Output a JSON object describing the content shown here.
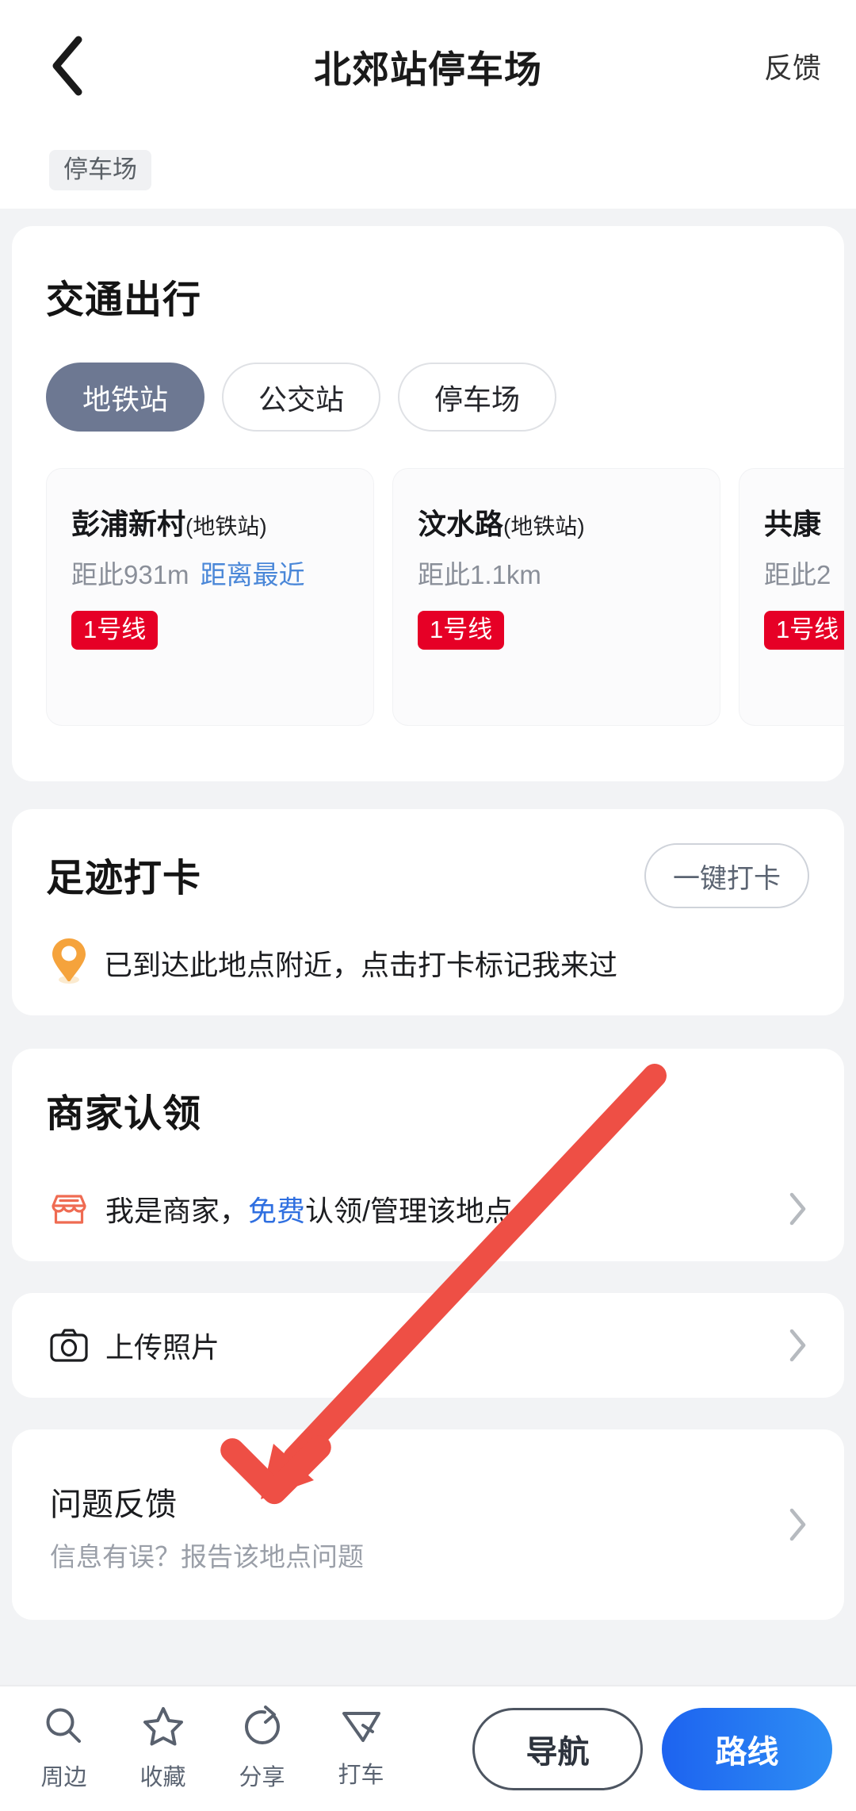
{
  "header": {
    "back_icon": "chevron-left-icon",
    "title": "北郊站停车场",
    "action_label": "反馈"
  },
  "tag": {
    "label": "停车场"
  },
  "traffic": {
    "title": "交通出行",
    "tabs": [
      {
        "label": "地铁站",
        "active": true
      },
      {
        "label": "公交站",
        "active": false
      },
      {
        "label": "停车场",
        "active": false
      }
    ],
    "stations": [
      {
        "name": "彭浦新村",
        "type": "(地铁站)",
        "distance": "距此931m",
        "nearest_label": "距离最近",
        "line": "1号线"
      },
      {
        "name": "汶水路",
        "type": "(地铁站)",
        "distance": "距此1.1km",
        "nearest_label": "",
        "line": "1号线"
      },
      {
        "name": "共康",
        "type": "",
        "distance": "距此2",
        "nearest_label": "",
        "line": "1号线"
      }
    ]
  },
  "footprint": {
    "title": "足迹打卡",
    "checkin_button": "一键打卡",
    "pin_icon": "location-pin-icon",
    "hint": "已到达此地点附近，点击打卡标记我来过"
  },
  "merchant": {
    "title": "商家认领",
    "store_icon": "store-icon",
    "text_before": "我是商家，",
    "free_label": "免费",
    "text_after": "认领/管理该地点",
    "chevron_icon": "chevron-right-icon"
  },
  "upload": {
    "camera_icon": "camera-icon",
    "label": "上传照片",
    "chevron_icon": "chevron-right-icon"
  },
  "feedback": {
    "title": "问题反馈",
    "subtitle": "信息有误？报告该地点问题",
    "chevron_icon": "chevron-right-icon"
  },
  "bottom_bar": {
    "items": [
      {
        "icon": "search-icon",
        "label": "周边"
      },
      {
        "icon": "star-icon",
        "label": "收藏"
      },
      {
        "icon": "share-icon",
        "label": "分享"
      },
      {
        "icon": "taxi-cursor-icon",
        "label": "打车"
      }
    ],
    "nav_button": "导航",
    "route_button": "路线"
  },
  "annotation": {
    "arrow_color": "#ee4f45",
    "arrow_points_to": "问题反馈"
  },
  "colors": {
    "page_bg": "#f2f3f5",
    "card_bg": "#ffffff",
    "accent_blue": "#1d63f0",
    "link_blue": "#2f6fe0",
    "metro_red": "#e60026",
    "tab_active": "#6d7892",
    "pin_orange": "#f5a33c",
    "store_orange": "#ef6b52",
    "annotation_red": "#ee4f45"
  }
}
